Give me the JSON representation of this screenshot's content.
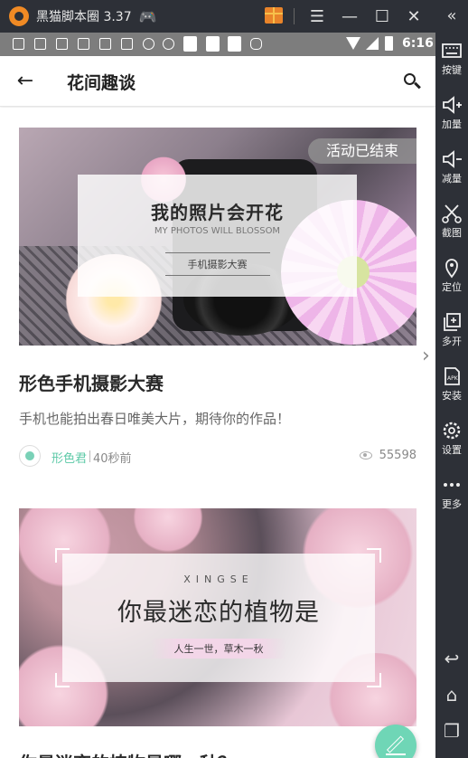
{
  "emulator": {
    "title": "黑猫脚本圈 3.37",
    "collapse_glyph": "«",
    "sidebar": [
      {
        "label": "按键",
        "icon": "keyboard-icon"
      },
      {
        "label": "加量",
        "icon": "volume-up-icon"
      },
      {
        "label": "减量",
        "icon": "volume-down-icon"
      },
      {
        "label": "截图",
        "icon": "scissors-icon"
      },
      {
        "label": "定位",
        "icon": "location-pin-icon"
      },
      {
        "label": "多开",
        "icon": "multi-instance-icon"
      },
      {
        "label": "安装",
        "icon": "apk-install-icon"
      },
      {
        "label": "设置",
        "icon": "gear-icon"
      },
      {
        "label": "更多",
        "icon": "more-dots-icon"
      }
    ]
  },
  "statusbar": {
    "time": "6:16"
  },
  "appbar": {
    "title": "花间趣谈"
  },
  "posts": [
    {
      "badge": "活动已结束",
      "banner_title": "我的照片会开花",
      "banner_subtitle": "MY PHOTOS WILL BLOSSOM",
      "banner_tag": "手机摄影大赛",
      "title": "形色手机摄影大赛",
      "desc": "手机也能拍出春日唯美大片，期待你的作品！",
      "author": "形色君",
      "time": "40秒前",
      "views": "55598"
    },
    {
      "banner_en": "XINGSE",
      "banner_title": "你最迷恋的植物是",
      "banner_tag": "人生一世，草木一秋",
      "title": "你最迷恋的植物是哪一种？"
    }
  ]
}
